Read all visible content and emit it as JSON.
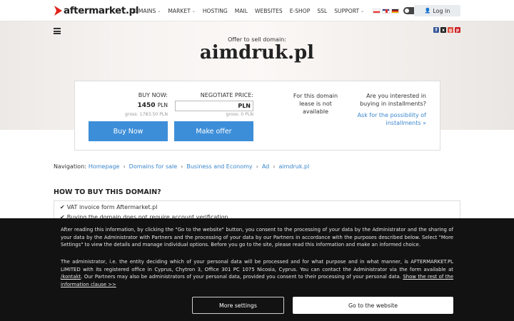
{
  "logo": {
    "text": "aftermarket.pl"
  },
  "nav": {
    "items": [
      {
        "label": "DOMAINS",
        "dropdown": true
      },
      {
        "label": "MARKET",
        "dropdown": true
      },
      {
        "label": "HOSTING",
        "dropdown": false
      },
      {
        "label": "MAIL",
        "dropdown": false
      },
      {
        "label": "WEBSITES",
        "dropdown": false
      },
      {
        "label": "E-SHOP",
        "dropdown": false
      },
      {
        "label": "SSL",
        "dropdown": false
      },
      {
        "label": "SUPPORT",
        "dropdown": true
      }
    ],
    "caret": "⌄",
    "login_label": "Log in",
    "login_icon": "user-icon"
  },
  "hero": {
    "offer_label": "Offer to sell domain:",
    "domain": "aimdruk.pl"
  },
  "price": {
    "buy_now_label": "BUY NOW:",
    "buy_price": "1450",
    "currency": "PLN",
    "buy_gross": "gross: 1783.50 PLN",
    "negotiate_label": "NEGOTIATE PRICE:",
    "negotiate_value": "PLN",
    "negotiate_gross": "gross: 0 PLN",
    "buy_button": "Buy Now",
    "offer_button": "Make offer",
    "lease_text": "For this domain lease is not available",
    "install_question": "Are you interested in buying in installments?",
    "install_link": "Ask for the possibility of installments »"
  },
  "breadcrumb": {
    "label": "Navigation:",
    "items": [
      "Homepage",
      "Domains for sale",
      "Business and Economy",
      "Ad",
      "aimdruk.pl"
    ],
    "sep": "›"
  },
  "howto": {
    "title": "HOW TO BUY THIS DOMAIN?",
    "rows": [
      "VAT invoice form Aftermarket.pl",
      "Buying the domain does not require account verification"
    ]
  },
  "cookie": {
    "p1": "After reading this information, by clicking the \"Go to the website\" button, you consent to the processing of your data by the Administrator and the sharing of your data by the Administrator with Partners and the processing of your data by our Partners in accordance with the purposes described below. Select \"More Settings\" to view the details and manage individual options. Before you go to the site, please read this information and make an informed choice.",
    "p2_text": "The administrator, i.e. the entity deciding which of your personal data will be processed and for what purpose and in what manner, is AFTERMARKET.PL LIMITED with its registered office in Cyprus, Chytron 3, Office 301 PC 1075 Nicosia, Cyprus. You can contact the Administrator via the form available at ",
    "p2_link1": "/kontakt",
    "p2_text2": ". Our Partners may also be administrators of your personal data, provided you consent to their processing of your personal data. ",
    "p2_link2": "Show the rest of the information clause >>",
    "more_settings": "More settings",
    "go_to_website": "Go to the website"
  },
  "colors": {
    "accent": "#3d8ed8",
    "link": "#3a86cc",
    "logo_red": "#e2231a",
    "overlay": "#121212"
  }
}
